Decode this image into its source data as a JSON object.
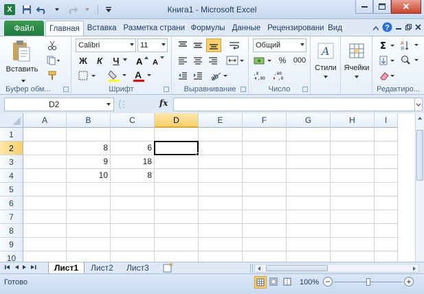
{
  "window": {
    "title": "Книга1 - Microsoft Excel",
    "logo": "X",
    "qat_icons": [
      "save-icon",
      "undo-icon",
      "redo-icon",
      "customize-icon"
    ],
    "controls": {
      "close": "✕"
    }
  },
  "ribbon_tabs": {
    "file": "Файл",
    "items": [
      "Главная",
      "Вставка",
      "Разметка страни",
      "Формулы",
      "Данные",
      "Рецензировани",
      "Вид"
    ],
    "active_index": 0
  },
  "ribbon": {
    "clipboard": {
      "label": "Буфер обм...",
      "paste": "Вставить"
    },
    "font": {
      "label": "Шрифт",
      "font_name": "Calibri",
      "font_size": "11",
      "bold": "Ж",
      "italic": "К",
      "underline": "Ч"
    },
    "alignment": {
      "label": "Выравнивание"
    },
    "number": {
      "label": "Число",
      "format": "Общий",
      "percent": "%",
      "thousands": "000"
    },
    "styles": {
      "label": "Стили"
    },
    "cells": {
      "label": "Ячейки"
    },
    "editing": {
      "label": "Редактиро..."
    },
    "colors": {
      "fill_highlight": "#ffff00",
      "font_color": "#ff0000",
      "accent_active_align": "#f8cf6b"
    }
  },
  "formula_bar": {
    "name_box": "D2",
    "fx": "fx",
    "formula": ""
  },
  "sheet": {
    "columns": [
      "A",
      "B",
      "C",
      "D",
      "E",
      "F",
      "G",
      "H",
      "I"
    ],
    "rows": [
      "1",
      "2",
      "3",
      "4",
      "5",
      "6",
      "7",
      "8",
      "9",
      "10"
    ],
    "selected_column": "D",
    "selected_row": "2",
    "active_cell": "D2",
    "cells": {
      "B2": "8",
      "C2": "6",
      "B3": "9",
      "C3": "18",
      "B4": "10",
      "C4": "8"
    }
  },
  "sheet_tabs": {
    "items": [
      "Лист1",
      "Лист2",
      "Лист3"
    ],
    "active_index": 0
  },
  "status_bar": {
    "ready": "Готово",
    "zoom": "100%",
    "zoom_minus": "−",
    "zoom_plus": "+"
  }
}
